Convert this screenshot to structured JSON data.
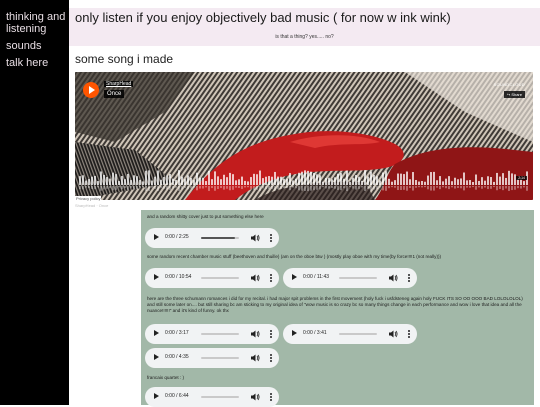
{
  "nav": {
    "items": [
      "thinking and listening",
      "sounds",
      "talk here"
    ]
  },
  "header": {
    "title": "only listen if you enjoy objectively bad music ( for now w ink wink)",
    "subtitle": "is that a thing? yes..... no?"
  },
  "section": {
    "title": "some song i made"
  },
  "soundcloud": {
    "artist": "SharpHead",
    "track": "Once",
    "logo": "SOUNDCLOUD",
    "share_label": "Share",
    "duration": "2:14",
    "privacy_label": "Privacy policy",
    "credit": "SharpHead · Once"
  },
  "audio_notes": [
    "and a random shitty cover just to put something else here",
    "some random recent chamber music stuff (beethoven and thuille) (am on the oboe btw ) (mostly play oboe with my time(by force!!!!1 (not really)))",
    "here are the three schumann romances i did for my recital. i had major spit problems in the first movement (holy fuck i usfdsteneg again holy FUCK ITS SO OO OOO BAD LOLOLOLOL) and still some later on.... but still sharing bc am sticking to my original idea of \"wow music is so crazy bc so many things change in each performance and wow i love that idea and all the nuance!!!!!!\" and it's kind of funny. ok thx",
    "francaix quartet : )"
  ],
  "audio_players": [
    {
      "time": "0:00 / 2:25",
      "progress": 0.9
    },
    {
      "time": "0:00 / 10:54",
      "progress": 0
    },
    {
      "time": "0:00 / 11:43",
      "progress": 0
    },
    {
      "time": "0:00 / 3:17",
      "progress": 0
    },
    {
      "time": "0:00 / 3:41",
      "progress": 0
    },
    {
      "time": "0:00 / 4:35",
      "progress": 0
    },
    {
      "time": "0:00 / 6:44",
      "progress": 0
    }
  ],
  "icons": {
    "play": "play-icon",
    "volume": "volume-icon",
    "more": "more-options-icon",
    "soundcloud": "soundcloud-logo-icon",
    "share": "share-icon"
  },
  "colors": {
    "sidebar_bg": "#000000",
    "nav_text": "#e7dde3",
    "header_bg": "#f4eaf2",
    "audio_section_bg": "#a2b8a8",
    "player_bg": "#f1f3f4",
    "soundcloud_orange": "#ff5500"
  }
}
